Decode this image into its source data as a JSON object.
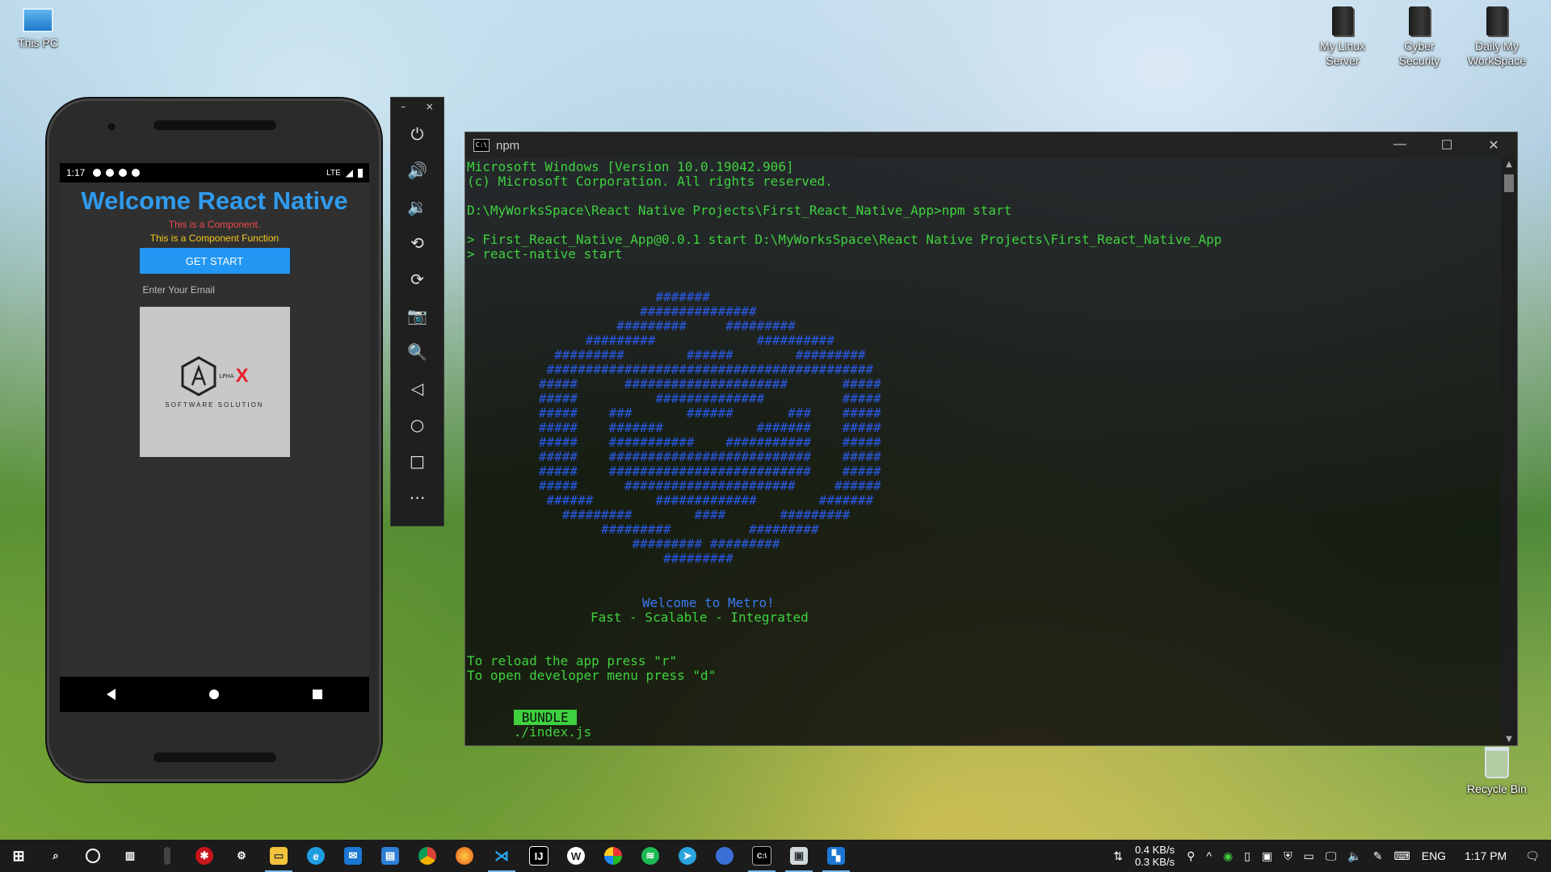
{
  "desktop": {
    "icons": [
      {
        "label": "This PC"
      },
      {
        "label": "My Linux Server"
      },
      {
        "label": "Cyber Security"
      },
      {
        "label": "Daily My WorkSpace"
      },
      {
        "label": "Recycle Bin"
      }
    ]
  },
  "phone": {
    "status_time": "1:17",
    "status_network": "LTE",
    "app_title": "Welcome React Native",
    "component_text": "This is a Component.",
    "component_function_text": "This is a Component Function",
    "button_label": "GET START",
    "email_placeholder": "Enter Your Email",
    "logo_letter": "X",
    "logo_small": "LPHA",
    "logo_tagline": "SOFTWARE SOLUTION"
  },
  "emulator_toolbar": {
    "minimize": "–",
    "close": "×",
    "tools": [
      "power-icon",
      "volume-up-icon",
      "volume-down-icon",
      "rotate-left-icon",
      "rotate-right-icon",
      "camera-icon",
      "zoom-icon",
      "back-icon",
      "home-icon",
      "overview-icon",
      "more-icon"
    ]
  },
  "terminal": {
    "title": "npm",
    "icon_text": "C:\\",
    "lines": [
      "Microsoft Windows [Version 10.0.19042.906]",
      "(c) Microsoft Corporation. All rights reserved.",
      "D:\\MyWorksSpace\\React Native Projects\\First_React_Native_App>npm start",
      "> First_React_Native_App@0.0.1 start D:\\MyWorksSpace\\React Native Projects\\First_React_Native_App",
      "> react-native start"
    ],
    "welcome": "Welcome to Metro!",
    "tagline": "Fast - Scalable - Integrated",
    "reload_hint": "To reload the app press \"r\"",
    "devmenu_hint": "To open developer menu press \"d\"",
    "bundle_badge": "BUNDLE",
    "bundle_path": "./index.js"
  },
  "taskbar": {
    "download_speed": "0.4 KB/s",
    "upload_speed": "0.3 KB/s",
    "language": "ENG",
    "time": "1:17 PM",
    "apps": [
      "start-icon",
      "search-icon",
      "cortana-icon",
      "task-view-icon",
      "app-icon",
      "antivirus-icon",
      "settings-icon",
      "file-explorer-icon",
      "edge-icon",
      "mail-icon",
      "store-icon",
      "chrome-icon",
      "firefox-icon",
      "vscode-icon",
      "intellij-icon",
      "wordpress-icon",
      "browser-icon",
      "spotify-icon",
      "telegram-icon",
      "app-icon-2",
      "terminal-icon",
      "app-icon-3",
      "app-icon-4"
    ]
  },
  "colors": {
    "terminal_green": "#3fd13f",
    "metro_blue": "#2a5ae8",
    "react_blue": "#2f9bef",
    "button_blue": "#2196f3"
  }
}
